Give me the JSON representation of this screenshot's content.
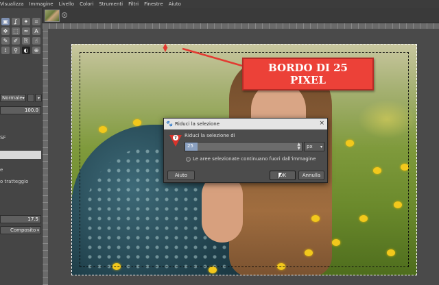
{
  "menubar": {
    "items": [
      "Visualizza",
      "Immagine",
      "Livello",
      "Colori",
      "Strumenti",
      "Filtri",
      "Finestre",
      "Aiuto"
    ]
  },
  "left_dock": {
    "mode_label": "Normale",
    "opacity_value": "100.0",
    "partial_text_1": "SF",
    "partial_text_2": "e",
    "partial_text_3": "o tratteggio",
    "size_value": "17.5",
    "composite_label": "Composito"
  },
  "callout": {
    "line1": "BORDO DI 25",
    "line2": "PIXEL",
    "color": "#ec4138"
  },
  "dialog": {
    "title": "Riduci la selezione",
    "label": "Riduci la selezione di",
    "value": "25",
    "unit": "px",
    "checkbox_label": "Le aree selezionate continuano fuori dall'immagine",
    "checkbox_checked": false,
    "help_button": "Aiuto",
    "ok_button": "OK",
    "cancel_button": "Annulla"
  },
  "icons": {
    "dialog_icon": "warning-question-icon",
    "close": "close-icon"
  }
}
